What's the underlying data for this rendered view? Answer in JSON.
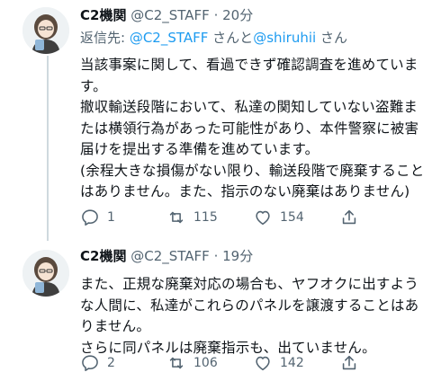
{
  "tweets": [
    {
      "name": "C2機関",
      "handle": "@C2_STAFF",
      "dot": "·",
      "time": "20分",
      "reply_prefix": "返信先: ",
      "reply_user1": "@C2_STAFF",
      "reply_mid": "さんと",
      "reply_user2": "@shiruhii",
      "reply_suffix": "さん",
      "body": "当該事案に関して、看過できず確認調査を進めています。\n撤収輸送段階において、私達の関知していない盗難または横領行為があった可能性があり、本件警察に被害届けを提出する準備を進めています。\n(余程大きな損傷がない限り、輸送段階で廃棄することはありません。また、指示のない廃棄はありません)",
      "replies": "1",
      "retweets": "115",
      "likes": "154"
    },
    {
      "name": "C2機関",
      "handle": "@C2_STAFF",
      "dot": "·",
      "time": "19分",
      "body": "また、正規な廃棄対応の場合も、ヤフオクに出すような人間に、私達がこれらのパネルを譲渡することはありません。\nさらに同パネルは廃棄指示も、出ていません。",
      "replies": "2",
      "retweets": "106",
      "likes": "142"
    }
  ],
  "icons": [
    "avatar",
    "reply-icon",
    "retweet-icon",
    "like-icon",
    "share-icon"
  ],
  "colors": {
    "link": "#1d9bf0",
    "secondary": "#536471",
    "text": "#0f1419",
    "thread_line": "#cfd9de"
  }
}
